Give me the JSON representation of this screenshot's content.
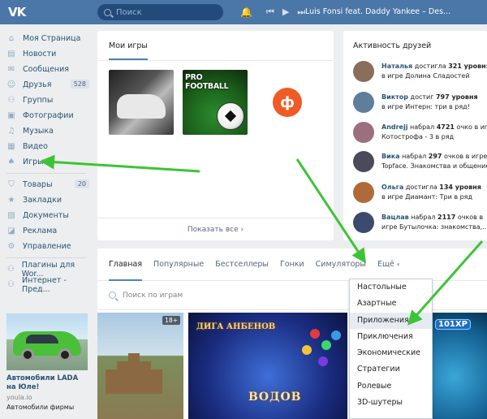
{
  "header": {
    "logo": "VK",
    "search_placeholder": "Поиск",
    "track": "Luis Fonsi feat. Daddy Yankee – Des..."
  },
  "leftnav": {
    "items": [
      {
        "label": "Моя Страница",
        "icon": "home-icon"
      },
      {
        "label": "Новости",
        "icon": "news-icon"
      },
      {
        "label": "Сообщения",
        "icon": "messages-icon"
      },
      {
        "label": "Друзья",
        "icon": "friends-icon",
        "count": "528"
      },
      {
        "label": "Группы",
        "icon": "groups-icon"
      },
      {
        "label": "Фотографии",
        "icon": "photos-icon"
      },
      {
        "label": "Музыка",
        "icon": "music-icon"
      },
      {
        "label": "Видео",
        "icon": "video-icon"
      },
      {
        "label": "Игры",
        "icon": "games-icon"
      }
    ],
    "items2": [
      {
        "label": "Товары",
        "icon": "goods-icon",
        "count": "20"
      },
      {
        "label": "Закладки",
        "icon": "bookmarks-icon"
      },
      {
        "label": "Документы",
        "icon": "documents-icon"
      },
      {
        "label": "Реклама",
        "icon": "ads-icon"
      },
      {
        "label": "Управление",
        "icon": "manage-icon"
      }
    ],
    "items3": [
      {
        "label": "Плагины для Wor...",
        "icon": "plugin-icon"
      },
      {
        "label": "Интернет - Пред...",
        "icon": "group-icon"
      }
    ]
  },
  "ad": {
    "title": "Автомобили LADA на Юле!",
    "domain": "youla.io",
    "text": "Автомобили фирмы"
  },
  "mygames": {
    "tab": "Мои игры",
    "thumb2_title": "PRO FOOTBALL",
    "thumb3_letter": "ф",
    "show_all": "Показать все"
  },
  "friends": {
    "title": "Активность друзей",
    "items": [
      {
        "name": "Наталья",
        "action": "достигла",
        "num": "321 уровня",
        "line2": "в игре Долина Сладостей",
        "color": "#8a6d5a"
      },
      {
        "name": "Виктор",
        "action": "достиг",
        "num": "797 уровня",
        "line2": "в игре Интерн: три в ряд!",
        "color": "#5e7e9c"
      },
      {
        "name": "Andrejj",
        "action": "набрал",
        "num": "4721",
        "tail": "очко в игре",
        "line2": "Котострофа - 3 в ряд",
        "color": "#9a6f7e"
      },
      {
        "name": "Вика",
        "action": "набрал",
        "num": "297",
        "tail": "очков в игре",
        "line2": "Topface. Знакомства и общение.",
        "color": "#4a4a5a"
      },
      {
        "name": "Ольга",
        "action": "достигла",
        "num": "134 уровня",
        "line2": "в игре Диамант: Три в ряд",
        "color": "#b06a3a"
      },
      {
        "name": "Вацлав",
        "action": "набрал",
        "num": "2117",
        "tail": "очков в",
        "line2": "игре Бутылочка: знакомства,...",
        "color": "#3c4a6e"
      }
    ]
  },
  "catalog": {
    "tabs": [
      "Главная",
      "Популярные",
      "Бестселлеры",
      "Гонки",
      "Симуляторы",
      "Ещё"
    ],
    "search_placeholder": "Поиск по играм",
    "badge": "18+",
    "banner2_title": "ДИГА АНБЕНОВ",
    "banner2_bottom": "ВОДОВ",
    "banner3_label": "101XP"
  },
  "dropdown": {
    "items": [
      "Настольные",
      "Азартные",
      "Приложения",
      "Приключения",
      "Экономические",
      "Стратегии",
      "Ролевые",
      "3D-шутеры"
    ]
  },
  "colors": {
    "brand": "#4a76a8",
    "accent": "#5181b8",
    "arrow": "#3cc436"
  }
}
